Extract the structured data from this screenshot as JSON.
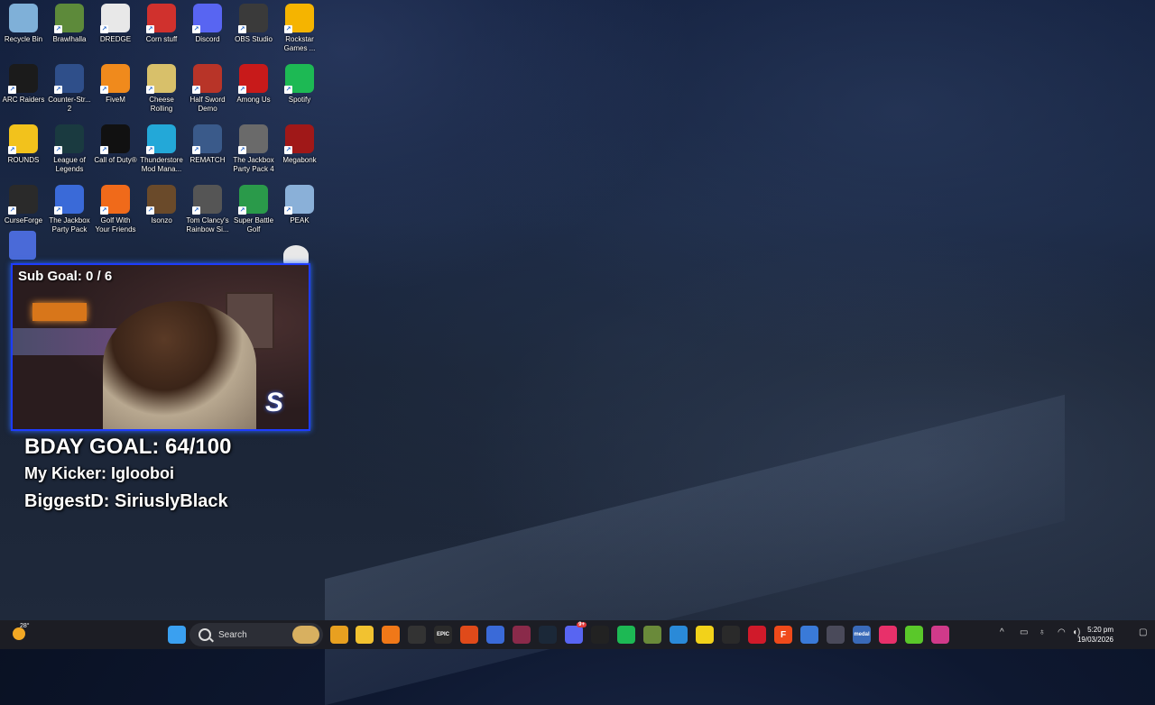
{
  "desktop": {
    "icons": [
      {
        "label": "Recycle Bin",
        "color": "#7fb0d8"
      },
      {
        "label": "Brawlhalla",
        "color": "#5d8a3a"
      },
      {
        "label": "DREDGE",
        "color": "#e8e8e8"
      },
      {
        "label": "Corn stuff",
        "color": "#d0312d"
      },
      {
        "label": "Discord",
        "color": "#5865f2"
      },
      {
        "label": "OBS Studio",
        "color": "#3a3a3a"
      },
      {
        "label": "Rockstar Games ...",
        "color": "#f5b400"
      },
      {
        "label": "ARC Raiders",
        "color": "#1b1b1b"
      },
      {
        "label": "Counter-Str... 2",
        "color": "#2f4f8a"
      },
      {
        "label": "FiveM",
        "color": "#f08a1c"
      },
      {
        "label": "Cheese Rolling",
        "color": "#d8c06a"
      },
      {
        "label": "Half Sword Demo",
        "color": "#b83428"
      },
      {
        "label": "Among Us",
        "color": "#c81a1a"
      },
      {
        "label": "Spotify",
        "color": "#1db954"
      },
      {
        "label": "ROUNDS",
        "color": "#f2c21c"
      },
      {
        "label": "League of Legends",
        "color": "#1a3a40"
      },
      {
        "label": "Call of Duty®",
        "color": "#111111"
      },
      {
        "label": "Thunderstore Mod Mana...",
        "color": "#23a8d8"
      },
      {
        "label": "REMATCH",
        "color": "#3a5a8a"
      },
      {
        "label": "The Jackbox Party Pack 4",
        "color": "#6a6a6a"
      },
      {
        "label": "Megabonk",
        "color": "#a01818"
      },
      {
        "label": "CurseForge",
        "color": "#2a2a2a"
      },
      {
        "label": "The Jackbox Party Pack",
        "color": "#3a6ad8"
      },
      {
        "label": "Golf With Your Friends",
        "color": "#f06a1a"
      },
      {
        "label": "Isonzo",
        "color": "#6a4a2a"
      },
      {
        "label": "Tom Clancy's Rainbow Si...",
        "color": "#555555"
      },
      {
        "label": "Super Battle Golf",
        "color": "#2a9a4a"
      },
      {
        "label": "PEAK",
        "color": "#8ab0d8"
      }
    ]
  },
  "stream_overlay": {
    "sub_goal": "Sub Goal:  0 / 6",
    "bday_goal": "BDAY GOAL: 64/100",
    "kicker": "My Kicker: Iglooboi",
    "biggest": "BiggestD: SiriuslyBlack"
  },
  "taskbar": {
    "weather_temp": "28°",
    "search_placeholder": "Search",
    "apps": [
      {
        "name": "start-button-icon",
        "color": "#3aa0f0"
      },
      {
        "name": "chrome-icon",
        "color": "#e8a020"
      },
      {
        "name": "file-explorer-icon",
        "color": "#f2c230"
      },
      {
        "name": "vlc-icon",
        "color": "#f07818"
      },
      {
        "name": "rockstar-launcher-icon",
        "color": "#333333"
      },
      {
        "name": "epic-games-icon",
        "color": "#2a2a2a"
      },
      {
        "name": "brawl-app-icon",
        "color": "#e04a1a"
      },
      {
        "name": "notepad-icon",
        "color": "#3a6ad8"
      },
      {
        "name": "game-launcher-icon",
        "color": "#8a2a4a"
      },
      {
        "name": "steam-icon",
        "color": "#1b2838"
      },
      {
        "name": "discord-icon",
        "color": "#5865f2"
      },
      {
        "name": "capcut-icon",
        "color": "#222222"
      },
      {
        "name": "spotify-icon",
        "color": "#1db954"
      },
      {
        "name": "xbox-app-icon",
        "color": "#6a8a3a"
      },
      {
        "name": "photos-icon",
        "color": "#2a8ad8"
      },
      {
        "name": "sticky-notes-icon",
        "color": "#f2d21a"
      },
      {
        "name": "terminal-icon",
        "color": "#2a2a2a"
      },
      {
        "name": "opera-gx-icon",
        "color": "#d01a2a"
      },
      {
        "name": "faceit-icon",
        "color": "#f04a1a"
      },
      {
        "name": "thunderstore-icon",
        "color": "#3a7ad8"
      },
      {
        "name": "obs-icon",
        "color": "#4a4a5a"
      },
      {
        "name": "media-app-icon",
        "color": "#3a6ab8"
      },
      {
        "name": "tiktok-icon",
        "color": "#e8306a"
      },
      {
        "name": "chat-app-icon",
        "color": "#5ac82a"
      },
      {
        "name": "game-pass-icon",
        "color": "#d03a8a"
      }
    ],
    "app_labels": [
      "",
      "",
      "",
      "",
      "",
      "EPIC",
      "",
      "",
      "",
      "",
      "",
      "",
      "",
      "",
      "",
      "",
      "",
      "",
      "F",
      "",
      "",
      "medal",
      "",
      "",
      ""
    ],
    "discord_badge": "9+",
    "time": "5:20 pm",
    "date": "19/03/2026"
  }
}
